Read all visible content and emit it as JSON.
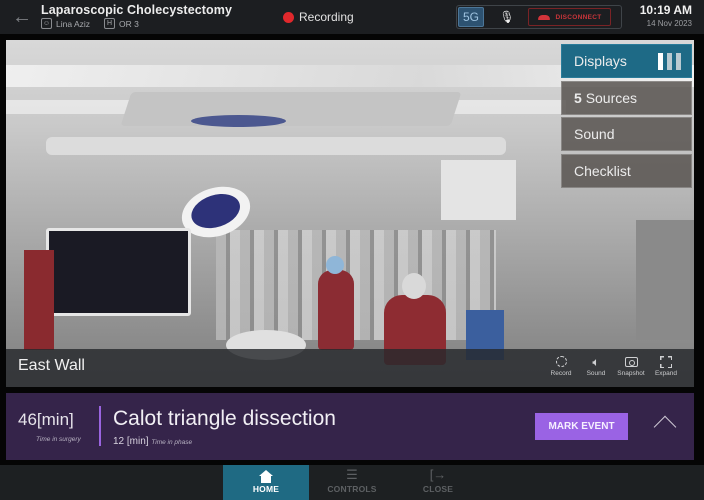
{
  "header": {
    "back_icon": "arrow-left-icon",
    "title": "Laparoscopic Cholecystectomy",
    "surgeon": "Lina Aziz",
    "surgeon_icon": "person-badge-icon",
    "room_icon_letter": "H",
    "room": "OR 3",
    "recording_label": "Recording",
    "recording_color": "#e0282c",
    "cast_icon": "5G",
    "mic_icon": "microphone-settings-icon",
    "disconnect_label": "DISCONNECT",
    "disconnect_color": "#c8353a",
    "time": "10:19 AM",
    "date": "14 Nov 2023"
  },
  "video": {
    "camera_name": "East Wall",
    "tools": [
      {
        "label": "Record",
        "icon": "record-icon"
      },
      {
        "label": "Sound",
        "icon": "speaker-icon"
      },
      {
        "label": "Snapshot",
        "icon": "camera-icon"
      },
      {
        "label": "Expand",
        "icon": "expand-icon"
      }
    ],
    "side_menu": [
      {
        "label": "Displays",
        "active": true
      },
      {
        "count": "5",
        "label": "Sources"
      },
      {
        "label": "Sound"
      },
      {
        "label": "Checklist"
      }
    ],
    "displays_selected": 1,
    "displays_total": 3
  },
  "phase": {
    "surgery_time_value": "46",
    "surgery_time_unit": "[min]",
    "surgery_time_label": "Time in surgery",
    "phase_name": "Calot triangle dissection",
    "phase_time_value": "12",
    "phase_time_unit": "[min]",
    "phase_time_label": "Time in phase",
    "mark_event_label": "MARK EVENT",
    "accent_color": "#9a63e4"
  },
  "nav": {
    "tabs": [
      {
        "label": "HOME",
        "icon": "home-icon",
        "active": true
      },
      {
        "label": "CONTROLS",
        "icon": "sliders-icon"
      },
      {
        "label": "CLOSE",
        "icon": "exit-icon"
      }
    ],
    "active_color": "#1f6a83"
  }
}
